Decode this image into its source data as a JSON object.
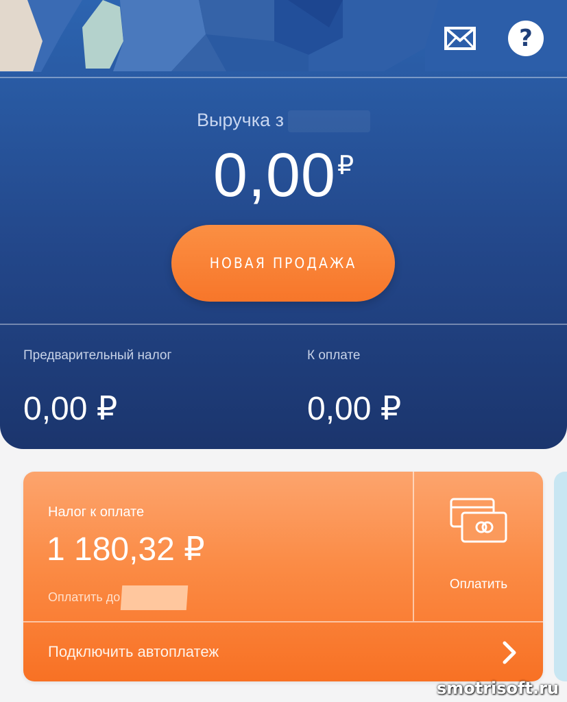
{
  "header": {
    "revenue_label": "Выручка з",
    "revenue_amount": "0,00",
    "currency": "₽",
    "new_sale_button": "НОВАЯ ПРОДАЖА",
    "icons": [
      "mail-icon",
      "help-icon"
    ],
    "help_glyph": "?"
  },
  "stats": {
    "preliminary_tax_label": "Предварительный налог",
    "preliminary_tax_value": "0,00 ₽",
    "to_pay_label": "К оплате",
    "to_pay_value": "0,00 ₽"
  },
  "tax_card": {
    "title": "Налог к оплате",
    "amount": "1 180,32 ₽",
    "due_label": "Оплатить до",
    "pay_button": "Оплатить",
    "autopay_label": "Подключить автоплатеж"
  },
  "watermark": "smotrisoft.ru",
  "colors": {
    "header_top": "#2c64b0",
    "header_bottom": "#1b356d",
    "accent_orange": "#f7762a",
    "background": "#f4f4f5"
  }
}
